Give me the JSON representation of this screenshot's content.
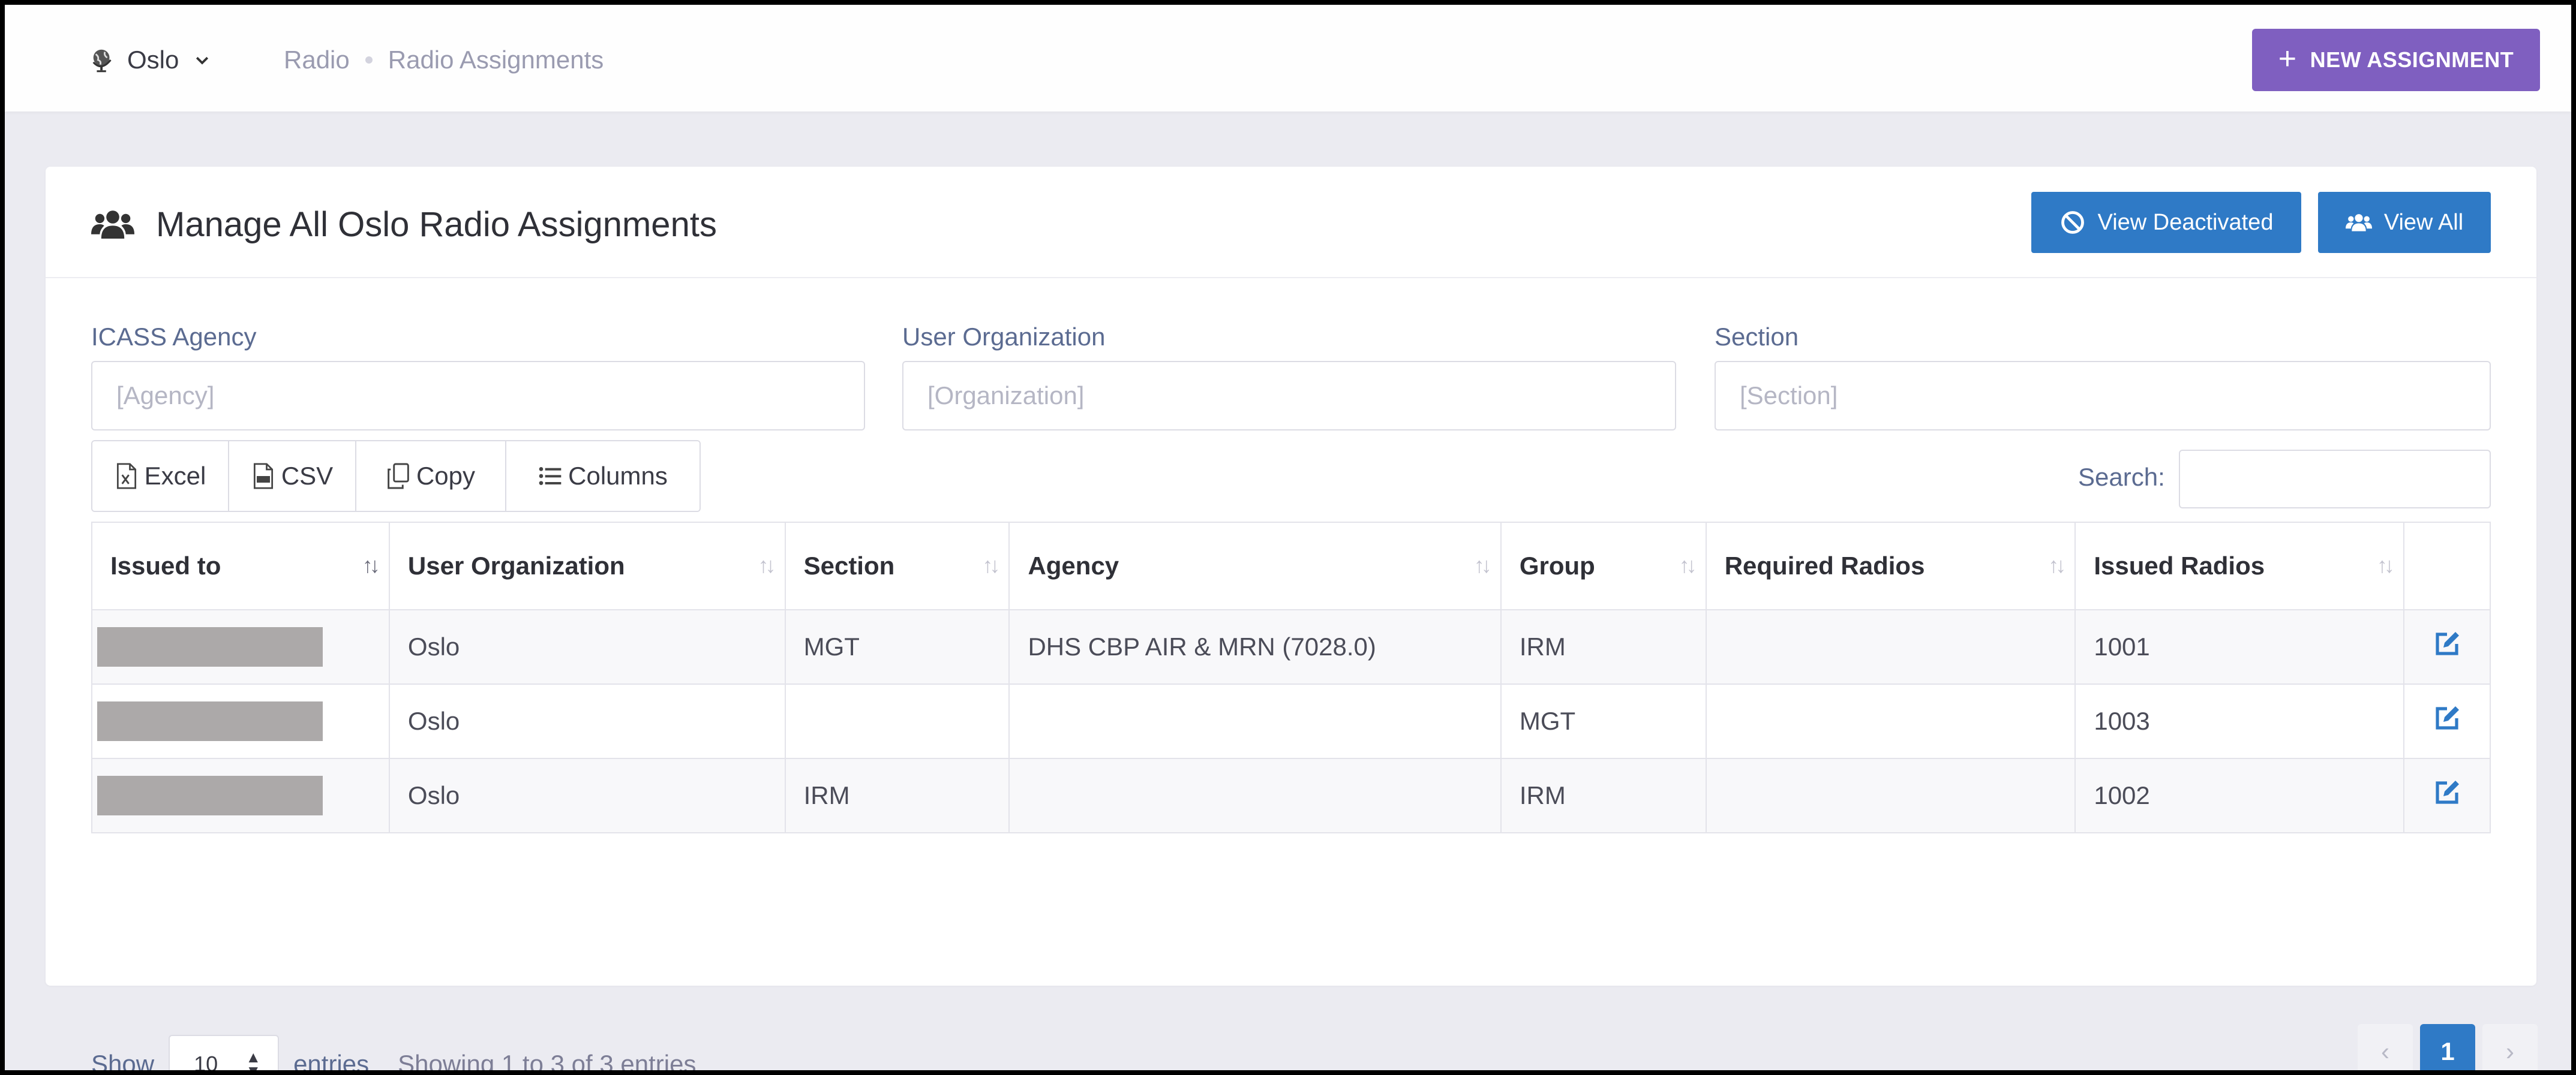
{
  "topbar": {
    "location": "Oslo",
    "breadcrumb": [
      "Radio",
      "Radio Assignments"
    ],
    "new_button": "NEW ASSIGNMENT"
  },
  "card": {
    "title": "Manage All Oslo Radio Assignments",
    "view_deactivated": "View Deactivated",
    "view_all": "View All"
  },
  "filters": {
    "agency": {
      "label": "ICASS Agency",
      "placeholder": "[Agency]"
    },
    "organization": {
      "label": "User Organization",
      "placeholder": "[Organization]"
    },
    "section": {
      "label": "Section",
      "placeholder": "[Section]"
    }
  },
  "exports": [
    "Excel",
    "CSV",
    "Copy",
    "Columns"
  ],
  "search": {
    "label": "Search:",
    "value": ""
  },
  "table": {
    "columns": [
      "Issued to",
      "User Organization",
      "Section",
      "Agency",
      "Group",
      "Required Radios",
      "Issued Radios"
    ],
    "rows": [
      {
        "issued_to": "",
        "organization": "Oslo",
        "section": "MGT",
        "agency": "DHS CBP AIR & MRN (7028.0)",
        "group": "IRM",
        "required": "",
        "issued": "1001"
      },
      {
        "issued_to": "",
        "organization": "Oslo",
        "section": "",
        "agency": "",
        "group": "MGT",
        "required": "",
        "issued": "1003"
      },
      {
        "issued_to": "",
        "organization": "Oslo",
        "section": "IRM",
        "agency": "",
        "group": "IRM",
        "required": "",
        "issued": "1002"
      }
    ]
  },
  "footer": {
    "show": "Show",
    "page_length": "10",
    "entries": "entries",
    "info": "Showing 1 to 3 of 3 entries",
    "pages": [
      "‹",
      "1",
      "›"
    ]
  },
  "colors": {
    "accent_purple": "#7f5fc0",
    "accent_blue": "#2f7ac6",
    "redaction": "#aca9a9"
  }
}
